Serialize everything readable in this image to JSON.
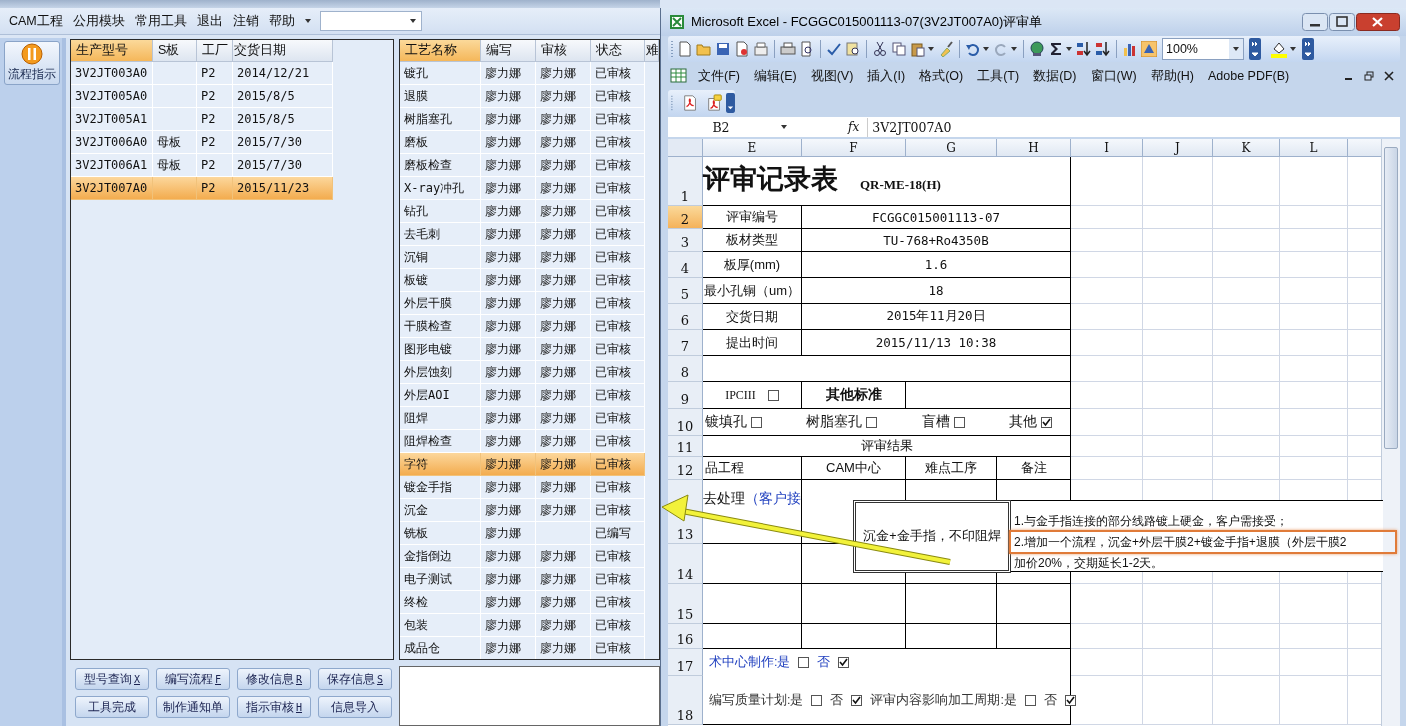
{
  "app": {
    "menu": [
      "CAM工程",
      "公用模块",
      "常用工具",
      "退出",
      "注销",
      "帮助"
    ],
    "side_button": "流程指示",
    "products": {
      "columns": [
        {
          "label": "生产型号",
          "selected": true
        },
        {
          "label": "S板",
          "selected": false
        },
        {
          "label": "工厂",
          "selected": false
        },
        {
          "label": "交货日期",
          "selected": false
        }
      ],
      "rows": [
        {
          "model": "3V2JT003A0",
          "factory": "P2",
          "date": "2014/12/21",
          "selected": false
        },
        {
          "model": "3V2JT005A0",
          "factory": "P2",
          "date": "2015/8/5",
          "selected": false
        },
        {
          "model": "3V2JT005A1",
          "factory": "P2",
          "date": "2015/8/5",
          "selected": false
        },
        {
          "model": "3V2JT006A0",
          "board": "母板",
          "factory": "P2",
          "date": "2015/7/30",
          "selected": false
        },
        {
          "model": "3V2JT006A1",
          "board": "母板",
          "factory": "P2",
          "date": "2015/7/30",
          "selected": false
        },
        {
          "model": "3V2JT007A0",
          "factory": "P2",
          "date": "2015/11/23",
          "selected": true
        }
      ]
    },
    "processes": {
      "columns": [
        {
          "label": "工艺名称",
          "selected": true
        },
        {
          "label": "编写",
          "selected": false
        },
        {
          "label": "审核",
          "selected": false
        },
        {
          "label": "状态",
          "selected": false
        },
        {
          "label": "难",
          "selected": false
        }
      ],
      "rows": [
        {
          "name": "镀孔",
          "author": "廖力娜",
          "reviewer": "廖力娜",
          "status": "已审核",
          "selected": false
        },
        {
          "name": "退膜",
          "author": "廖力娜",
          "reviewer": "廖力娜",
          "status": "已审核",
          "selected": false
        },
        {
          "name": "树脂塞孔",
          "author": "廖力娜",
          "reviewer": "廖力娜",
          "status": "已审核",
          "selected": false
        },
        {
          "name": "磨板",
          "author": "廖力娜",
          "reviewer": "廖力娜",
          "status": "已审核",
          "selected": false
        },
        {
          "name": "磨板检查",
          "author": "廖力娜",
          "reviewer": "廖力娜",
          "status": "已审核",
          "selected": false
        },
        {
          "name": "X-ray冲孔",
          "author": "廖力娜",
          "reviewer": "廖力娜",
          "status": "已审核",
          "selected": false
        },
        {
          "name": "钻孔",
          "author": "廖力娜",
          "reviewer": "廖力娜",
          "status": "已审核",
          "selected": false
        },
        {
          "name": "去毛刺",
          "author": "廖力娜",
          "reviewer": "廖力娜",
          "status": "已审核",
          "selected": false
        },
        {
          "name": "沉铜",
          "author": "廖力娜",
          "reviewer": "廖力娜",
          "status": "已审核",
          "selected": false
        },
        {
          "name": "板镀",
          "author": "廖力娜",
          "reviewer": "廖力娜",
          "status": "已审核",
          "selected": false
        },
        {
          "name": "外层干膜",
          "author": "廖力娜",
          "reviewer": "廖力娜",
          "status": "已审核",
          "selected": false
        },
        {
          "name": "干膜检查",
          "author": "廖力娜",
          "reviewer": "廖力娜",
          "status": "已审核",
          "selected": false
        },
        {
          "name": "图形电镀",
          "author": "廖力娜",
          "reviewer": "廖力娜",
          "status": "已审核",
          "selected": false
        },
        {
          "name": "外层蚀刻",
          "author": "廖力娜",
          "reviewer": "廖力娜",
          "status": "已审核",
          "selected": false
        },
        {
          "name": "外层AOI",
          "author": "廖力娜",
          "reviewer": "廖力娜",
          "status": "已审核",
          "selected": false
        },
        {
          "name": "阻焊",
          "author": "廖力娜",
          "reviewer": "廖力娜",
          "status": "已审核",
          "selected": false
        },
        {
          "name": "阻焊检查",
          "author": "廖力娜",
          "reviewer": "廖力娜",
          "status": "已审核",
          "selected": false
        },
        {
          "name": "字符",
          "author": "廖力娜",
          "reviewer": "廖力娜",
          "status": "已审核",
          "selected": true
        },
        {
          "name": "镀金手指",
          "author": "廖力娜",
          "reviewer": "廖力娜",
          "status": "已审核",
          "selected": false
        },
        {
          "name": "沉金",
          "author": "廖力娜",
          "reviewer": "廖力娜",
          "status": "已审核",
          "selected": false
        },
        {
          "name": "铣板",
          "author": "廖力娜",
          "status": "已编写",
          "selected": false
        },
        {
          "name": "金指倒边",
          "author": "廖力娜",
          "reviewer": "廖力娜",
          "status": "已审核",
          "selected": false
        },
        {
          "name": "电子测试",
          "author": "廖力娜",
          "reviewer": "廖力娜",
          "status": "已审核",
          "selected": false
        },
        {
          "name": "终检",
          "author": "廖力娜",
          "reviewer": "廖力娜",
          "status": "已审核",
          "selected": false
        },
        {
          "name": "包装",
          "author": "廖力娜",
          "reviewer": "廖力娜",
          "status": "已审核",
          "selected": false
        },
        {
          "name": "成品仓",
          "author": "廖力娜",
          "reviewer": "廖力娜",
          "status": "已审核",
          "selected": false
        }
      ]
    },
    "buttons": [
      {
        "label": "型号查询",
        "shortcut": "X"
      },
      {
        "label": "编写流程",
        "shortcut": "F"
      },
      {
        "label": "修改信息",
        "shortcut": "R"
      },
      {
        "label": "保存信息",
        "shortcut": "S"
      },
      {
        "label": "工具完成"
      },
      {
        "label": "制作通知单"
      },
      {
        "label": "指示审核",
        "shortcut": "H"
      },
      {
        "label": "信息导入"
      }
    ]
  },
  "excel": {
    "title": "Microsoft Excel - FCGGC015001113-07(3V2JT007A0)评审单",
    "zoom": "100%",
    "menu": [
      "文件(F)",
      "编辑(E)",
      "视图(V)",
      "插入(I)",
      "格式(O)",
      "工具(T)",
      "数据(D)",
      "窗口(W)",
      "帮助(H)",
      "Adobe PDF(B)"
    ],
    "name_box": "B2",
    "function_label": "fx",
    "formula": "3V2JT007A0",
    "columns": [
      "E",
      "F",
      "G",
      "H",
      "I",
      "J",
      "K",
      "L"
    ],
    "rows": [
      {
        "number": "1",
        "kind": "title",
        "title": "评审记录表",
        "code": "QR-ME-18(H)",
        "selected": false
      },
      {
        "number": "2",
        "kind": "field",
        "label": "评审编号",
        "value": "FCGGC015001113-07",
        "selected": true
      },
      {
        "number": "3",
        "kind": "field",
        "label": "板材类型",
        "value": "TU-768+Ro4350B",
        "selected": false
      },
      {
        "number": "4",
        "kind": "field",
        "label": "板厚(mm)",
        "value": "1.6",
        "selected": false
      },
      {
        "number": "5",
        "kind": "field",
        "label": "最小孔铜（um）",
        "value": "18",
        "selected": false
      },
      {
        "number": "6",
        "kind": "field",
        "label": "交货日期",
        "value": "2015年11月20日",
        "selected": false
      },
      {
        "number": "7",
        "kind": "field",
        "label": "提出时间",
        "value": "2015/11/13 10:38",
        "selected": false
      },
      {
        "number": "8",
        "kind": "blank",
        "selected": false
      },
      {
        "number": "9",
        "kind": "standard",
        "option": {
          "label": "IPCIII",
          "checked": false
        },
        "standard": "其他标准",
        "selected": false
      },
      {
        "number": "10",
        "kind": "options",
        "options": [
          {
            "label": "镀填孔",
            "checked": false
          },
          {
            "label": "树脂塞孔",
            "checked": false
          },
          {
            "label": "盲槽",
            "checked": false
          },
          {
            "label": "其他",
            "checked": true
          }
        ],
        "selected": false
      },
      {
        "number": "11",
        "kind": "section",
        "text": "评审结果",
        "selected": false
      },
      {
        "number": "12",
        "kind": "headers",
        "cells": [
          "品工程",
          "CAM中心",
          "难点工序",
          "备注"
        ],
        "selected": false
      },
      {
        "number": "13",
        "kind": "result",
        "text": "去处理",
        "note": "（客户接",
        "selected": false
      },
      {
        "number": "14",
        "kind": "empty",
        "selected": false
      },
      {
        "number": "15",
        "kind": "empty",
        "selected": false
      },
      {
        "number": "16",
        "kind": "empty",
        "selected": false
      },
      {
        "number": "17",
        "kind": "flags",
        "emphasis": true,
        "parts": [
          {
            "kind": "text",
            "text": "术中心制作:是"
          },
          {
            "kind": "check",
            "checked": false
          },
          {
            "kind": "text",
            "text": "否"
          },
          {
            "kind": "check",
            "checked": true
          }
        ],
        "selected": false
      },
      {
        "number": "18",
        "kind": "flags",
        "emphasis": false,
        "parts": [
          {
            "kind": "text",
            "text": "编写质量计划:是"
          },
          {
            "kind": "check",
            "checked": false
          },
          {
            "kind": "text",
            "text": "否"
          },
          {
            "kind": "check",
            "checked": true
          },
          {
            "kind": "text",
            "text": "评审内容影响加工周期:是"
          },
          {
            "kind": "check",
            "checked": false
          },
          {
            "kind": "text",
            "text": "否"
          },
          {
            "kind": "check",
            "checked": true
          }
        ],
        "selected": false
      }
    ],
    "text_box": "沉金+金手指，不印阻焊",
    "note_lines": [
      "1.与金手指连接的部分线路镀上硬金，客户需接受；",
      "2.增加一个流程，沉金+外层干膜2+镀金手指+退膜（外层干膜2",
      "加价20%，交期延长1-2天。"
    ]
  }
}
